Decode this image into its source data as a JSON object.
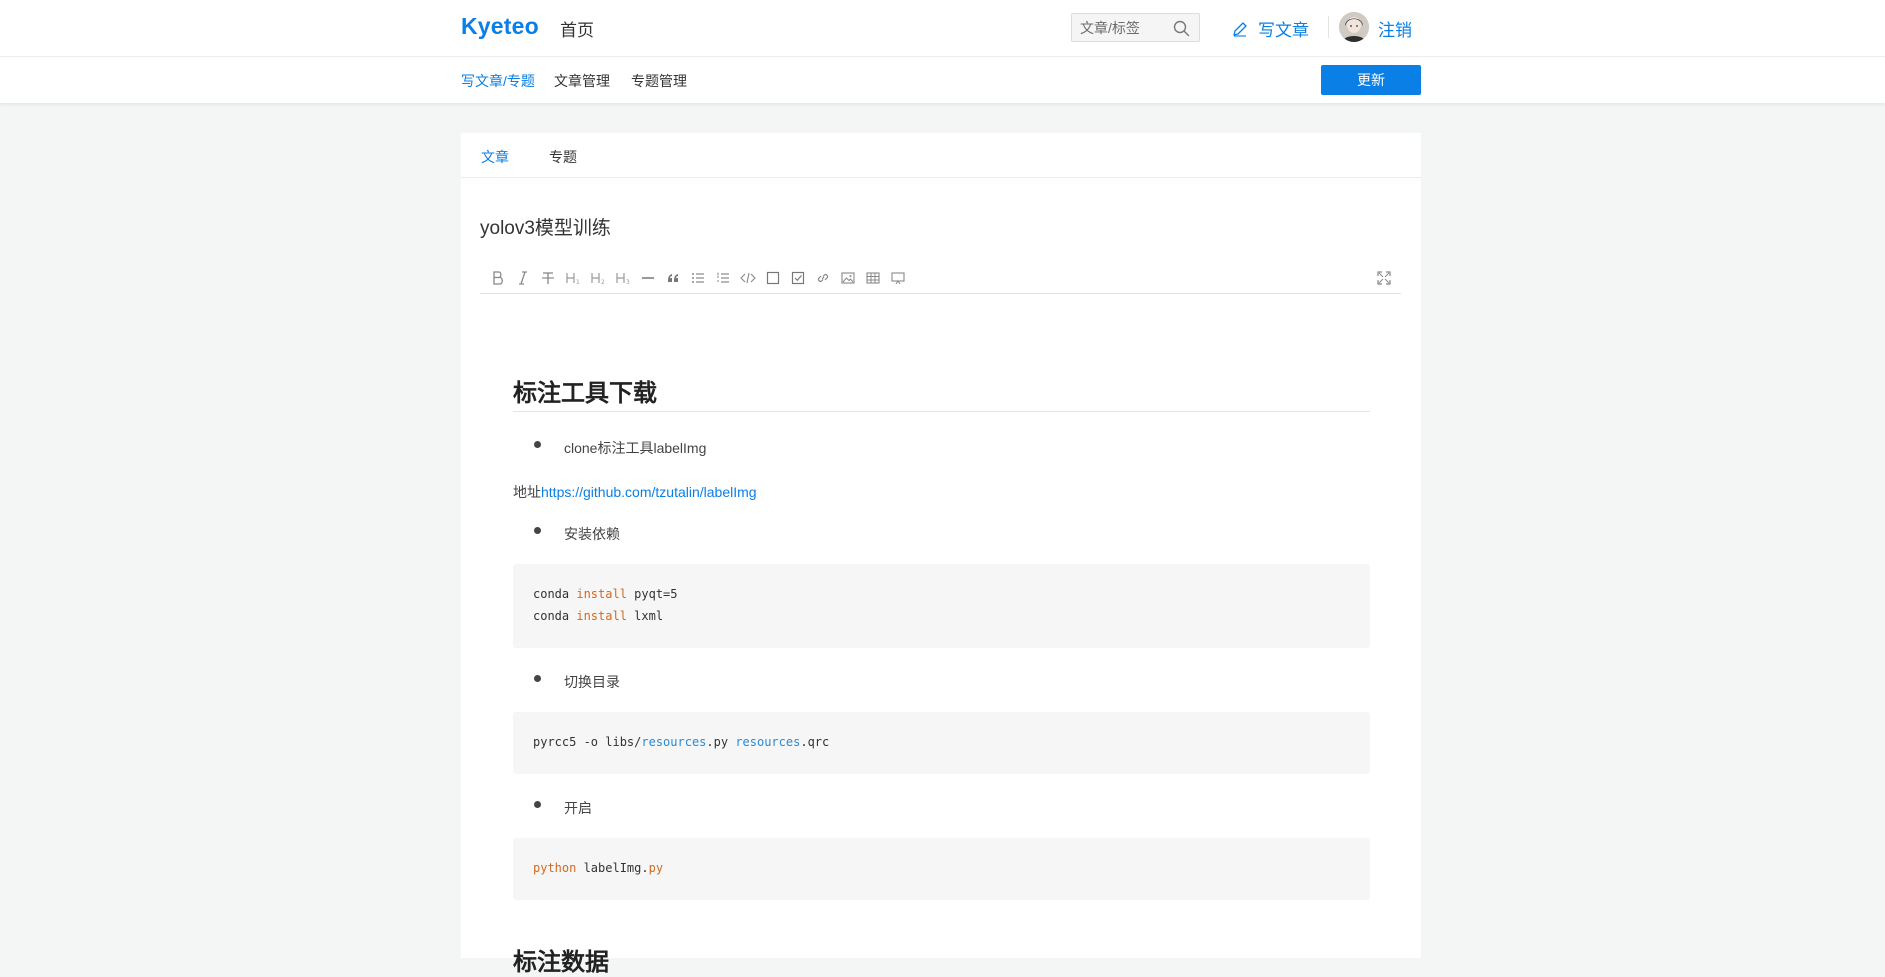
{
  "header": {
    "brand": "Kyeteo",
    "home_label": "首页",
    "search_placeholder": "文章/标签",
    "write_label": "写文章",
    "logout_label": "注销"
  },
  "subnav": {
    "items": [
      "写文章/专题",
      "文章管理",
      "专题管理"
    ],
    "active_index": 0,
    "update_label": "更新"
  },
  "editor": {
    "tabs": [
      "文章",
      "专题"
    ],
    "active_tab": 0,
    "title": "yolov3模型训练",
    "toolbar_icons": [
      "bold-icon",
      "italic-icon",
      "strikethrough-icon",
      "heading1-icon",
      "heading2-icon",
      "heading3-icon",
      "horizontal-rule-icon",
      "quote-icon",
      "unordered-list-icon",
      "ordered-list-icon",
      "code-icon",
      "checkbox-empty-icon",
      "checkbox-checked-icon",
      "link-icon",
      "image-icon",
      "table-icon",
      "preview-icon",
      "fullscreen-icon"
    ]
  },
  "content": {
    "heading1": "标注工具下载",
    "bullet1": "clone标注工具labelImg",
    "address_prefix": "地址",
    "address_link": "https://github.com/tzutalin/labelImg",
    "bullet2": "安装依赖",
    "code1": {
      "line1": {
        "a": "conda ",
        "b": "install",
        "c": " pyqt=5"
      },
      "line2": {
        "a": "conda ",
        "b": "install",
        "c": " lxml"
      }
    },
    "bullet3": "切换目录",
    "code2": {
      "a": "pyrcc5 -o libs/",
      "b": "resources",
      "c": ".py ",
      "d": "resources",
      "e": ".qrc"
    },
    "bullet4": "开启",
    "code3": {
      "a": "python",
      "b": " labelImg.",
      "c": "py"
    },
    "heading2": "标注数据"
  },
  "colors": {
    "accent": "#0a7fe6",
    "code_keyword": "#d2691e",
    "code_type": "#2a8ad4"
  }
}
